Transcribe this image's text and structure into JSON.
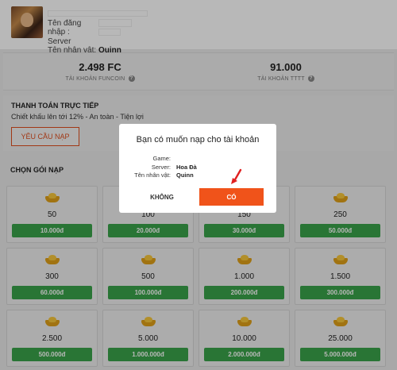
{
  "profile": {
    "login_label": "Tên đăng nhập :",
    "login_value": "",
    "server_label": "Server",
    "server_value": "",
    "character_label": "Tên nhân vật:",
    "character_value": "Quinn"
  },
  "balances": {
    "funcoin": {
      "value": "2.498 FC",
      "label": "TÀI KHOẢN FUNCOIN"
    },
    "tttt": {
      "value": "91.000",
      "label": "TÀI KHOẢN TTTT"
    },
    "help_icon": "?"
  },
  "direct_payment": {
    "title": "THANH TOÁN TRỰC TIẾP",
    "description": "Chiết khấu lên tới 12% - An toàn - Tiện lợi",
    "request_button": "YÊU CẦU NẠP"
  },
  "packages_title": "CHỌN GÓI NẠP",
  "packages": [
    {
      "amount": "50",
      "price": "10.000đ"
    },
    {
      "amount": "100",
      "price": "20.000đ"
    },
    {
      "amount": "150",
      "price": "30.000đ"
    },
    {
      "amount": "250",
      "price": "50.000đ"
    },
    {
      "amount": "300",
      "price": "60.000đ"
    },
    {
      "amount": "500",
      "price": "100.000đ"
    },
    {
      "amount": "1.000",
      "price": "200.000đ"
    },
    {
      "amount": "1.500",
      "price": "300.000đ"
    },
    {
      "amount": "2.500",
      "price": "500.000đ"
    },
    {
      "amount": "5.000",
      "price": "1.000.000đ"
    },
    {
      "amount": "10.000",
      "price": "2.000.000đ"
    },
    {
      "amount": "25.000",
      "price": "5.000.000đ"
    }
  ],
  "dialog": {
    "title": "Bạn có muốn nạp cho tài khoản",
    "game_label": "Game:",
    "game_value": "",
    "server_label": "Server:",
    "server_value": "Hoa Đà",
    "character_label": "Tên nhân vật:",
    "character_value": "Quinn",
    "no_button": "KHÔNG",
    "yes_button": "CÓ"
  },
  "colors": {
    "accent": "#f0531a",
    "price_green": "#3aa34a",
    "arrow_red": "#e02020"
  },
  "icons": [
    "gold-ingot-icon",
    "help-icon",
    "red-arrow-icon"
  ]
}
